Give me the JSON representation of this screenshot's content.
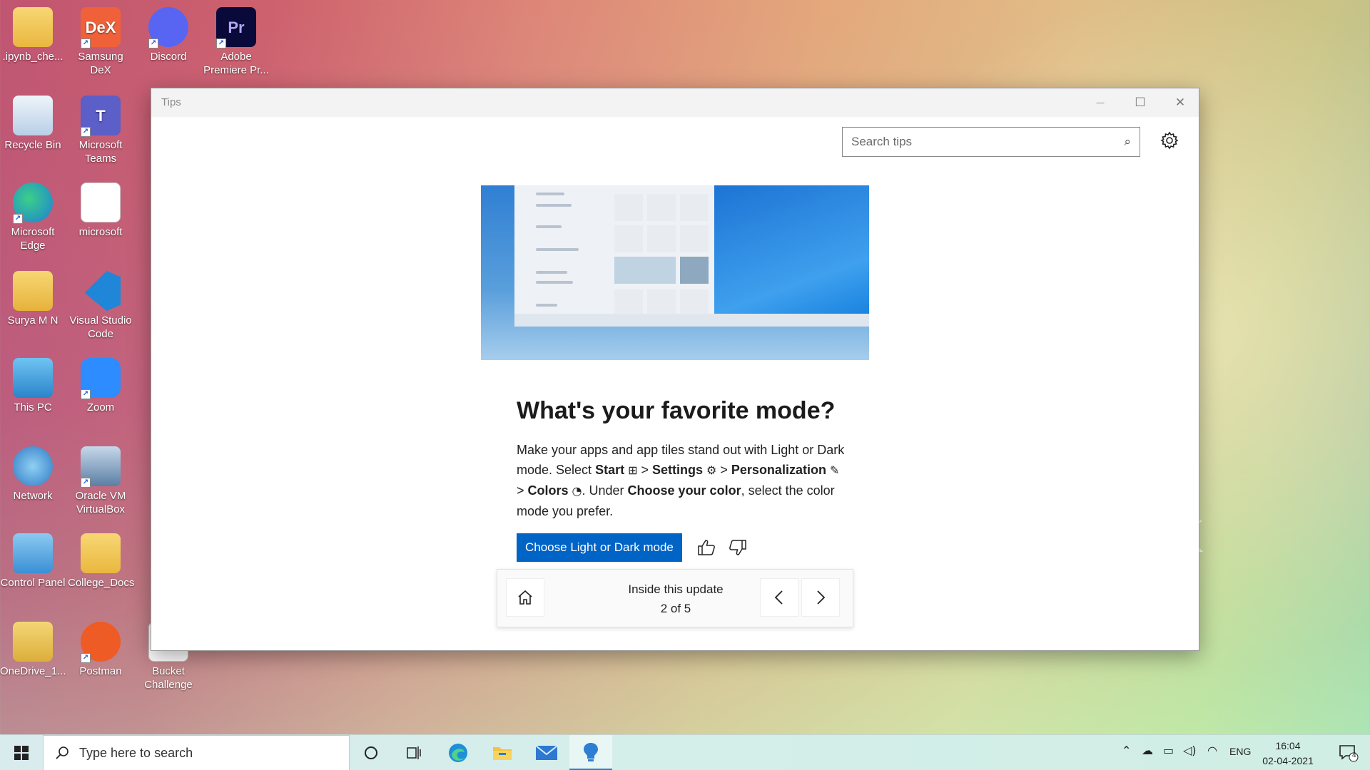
{
  "desktop": {
    "icons": [
      {
        "label": ".ipynb_che...",
        "icon": "folder-icon"
      },
      {
        "label": "Samsung DeX",
        "icon": "samsung-dex-icon",
        "glyph": "DeX"
      },
      {
        "label": "Discord",
        "icon": "discord-icon"
      },
      {
        "label": "Adobe Premiere Pr...",
        "icon": "premiere-icon",
        "glyph": "Pr"
      },
      {
        "label": "Recycle Bin",
        "icon": "recycle-bin-icon"
      },
      {
        "label": "Microsoft Teams",
        "icon": "teams-icon",
        "glyph": "T"
      },
      {
        "label": "Microsoft Edge",
        "icon": "edge-icon"
      },
      {
        "label": "microsoft",
        "icon": "document-icon"
      },
      {
        "label": "Surya M N",
        "icon": "user-folder-icon"
      },
      {
        "label": "Visual Studio Code",
        "icon": "vscode-icon"
      },
      {
        "label": "This PC",
        "icon": "this-pc-icon"
      },
      {
        "label": "Zoom",
        "icon": "zoom-icon"
      },
      {
        "label": "Network",
        "icon": "network-icon"
      },
      {
        "label": "Oracle VM VirtualBox",
        "icon": "virtualbox-icon"
      },
      {
        "label": "Control Panel",
        "icon": "control-panel-icon"
      },
      {
        "label": "College_Docs",
        "icon": "folder-icon"
      },
      {
        "label": "OneDrive_1...",
        "icon": "zip-folder-icon"
      },
      {
        "label": "Postman",
        "icon": "postman-icon"
      },
      {
        "label": "Bucket Challenge",
        "icon": "document-icon"
      }
    ],
    "wallpaper_text": "k"
  },
  "window": {
    "title": "Tips",
    "minimize": "—",
    "maximize": "☐",
    "close": "✕",
    "search_placeholder": "Search tips"
  },
  "tip": {
    "headline": "What's your favorite mode?",
    "body_1": "Make your apps and app tiles stand out with Light or Dark mode. Select ",
    "start": "Start",
    "sep_1": " > ",
    "settings": "Settings",
    "sep_2": " > ",
    "personalization": "Personalization",
    "sep_3": " > ",
    "colors": "Colors",
    "body_2": ". Under ",
    "choose_your_color": "Choose your color",
    "body_3": ", select the color mode you prefer.",
    "cta": "Choose Light or Dark mode"
  },
  "nav": {
    "title": "Inside this update",
    "count": "2 of 5"
  },
  "taskbar": {
    "search_placeholder": "Type here to search",
    "language": "ENG",
    "time": "16:04",
    "date": "02-04-2021",
    "notification_count": "4"
  },
  "colors": {
    "accent": "#0063c6",
    "taskbar": "#d8ecee"
  }
}
